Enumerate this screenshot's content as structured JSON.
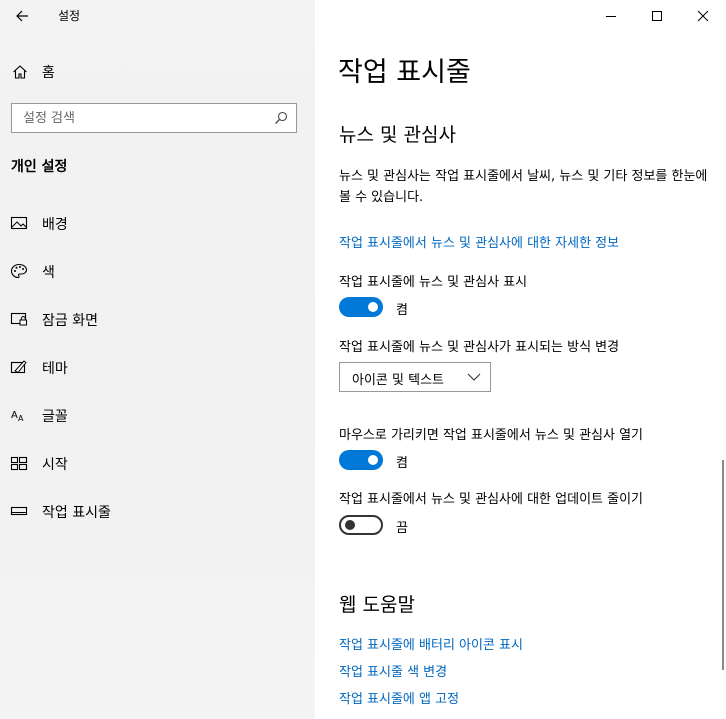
{
  "app": {
    "title": "설정"
  },
  "sidebar": {
    "home_label": "홈",
    "search_placeholder": "설정 검색",
    "section_title": "개인 설정",
    "items": [
      {
        "label": "배경",
        "icon": "picture-icon"
      },
      {
        "label": "색",
        "icon": "palette-icon"
      },
      {
        "label": "잠금 화면",
        "icon": "lock-screen-icon"
      },
      {
        "label": "테마",
        "icon": "theme-icon"
      },
      {
        "label": "글꼴",
        "icon": "font-icon"
      },
      {
        "label": "시작",
        "icon": "start-icon"
      },
      {
        "label": "작업 표시줄",
        "icon": "taskbar-icon"
      }
    ]
  },
  "main": {
    "page_title": "작업 표시줄",
    "news": {
      "heading": "뉴스 및 관심사",
      "description": "뉴스 및 관심사는 작업 표시줄에서 날씨, 뉴스 및 기타 정보를 한눈에 볼 수 있습니다.",
      "link": "작업 표시줄에서 뉴스 및 관심사에 대한 자세한 정보",
      "show_label": "작업 표시줄에 뉴스 및 관심사 표시",
      "show_state": "켬",
      "show_on": true,
      "mode_label": "작업 표시줄에 뉴스 및 관심사가 표시되는 방식 변경",
      "mode_value": "아이콘 및 텍스트",
      "hover_label": "마우스로 가리키면 작업 표시줄에서 뉴스 및 관심사 열기",
      "hover_state": "켬",
      "hover_on": true,
      "reduce_label": "작업 표시줄에서 뉴스 및 관심사에 대한 업데이트 줄이기",
      "reduce_state": "끔",
      "reduce_on": false
    },
    "help": {
      "heading": "웹 도움말",
      "links": [
        "작업 표시줄에 배터리 아이콘 표시",
        "작업 표시줄 색 변경",
        "작업 표시줄에 앱 고정"
      ]
    }
  },
  "colors": {
    "accent": "#0078d7",
    "link": "#0067c0",
    "sidebar_bg": "#f2f2f2"
  }
}
